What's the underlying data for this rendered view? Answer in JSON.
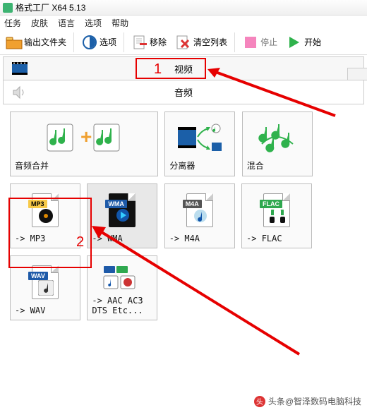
{
  "window": {
    "title": "格式工厂 X64 5.13"
  },
  "menu": {
    "items": [
      "任务",
      "皮肤",
      "语言",
      "选项",
      "帮助"
    ]
  },
  "toolbar": {
    "output_folder": "输出文件夹",
    "options": "选项",
    "remove": "移除",
    "clear_list": "清空列表",
    "stop": "停止",
    "start": "开始"
  },
  "categories": {
    "video": "视频",
    "audio": "音频"
  },
  "cards_top": [
    {
      "label": "音频合并"
    },
    {
      "label": "分离器"
    },
    {
      "label": "混合"
    }
  ],
  "cards_mid": [
    {
      "badge": "MP3",
      "badge_bg": "#f7c948",
      "label": "-> MP3"
    },
    {
      "badge": "WMA",
      "badge_bg": "#1e5aa8",
      "badge_fg": "#fff",
      "label": "-> WMA"
    },
    {
      "badge": "M4A",
      "badge_bg": "#555",
      "badge_fg": "#fff",
      "label": "-> M4A"
    },
    {
      "badge": "FLAC",
      "badge_bg": "#2fa84f",
      "badge_fg": "#fff",
      "label": "-> FLAC"
    }
  ],
  "cards_bot": [
    {
      "badge": "WAV",
      "badge_bg": "#1e5aa8",
      "badge_fg": "#fff",
      "label": "-> WAV"
    },
    {
      "label": "-> AAC AC3\nDTS Etc..."
    }
  ],
  "annotations": {
    "n1": "1",
    "n2": "2"
  },
  "watermark": "头条@智泽数码电脑科技"
}
